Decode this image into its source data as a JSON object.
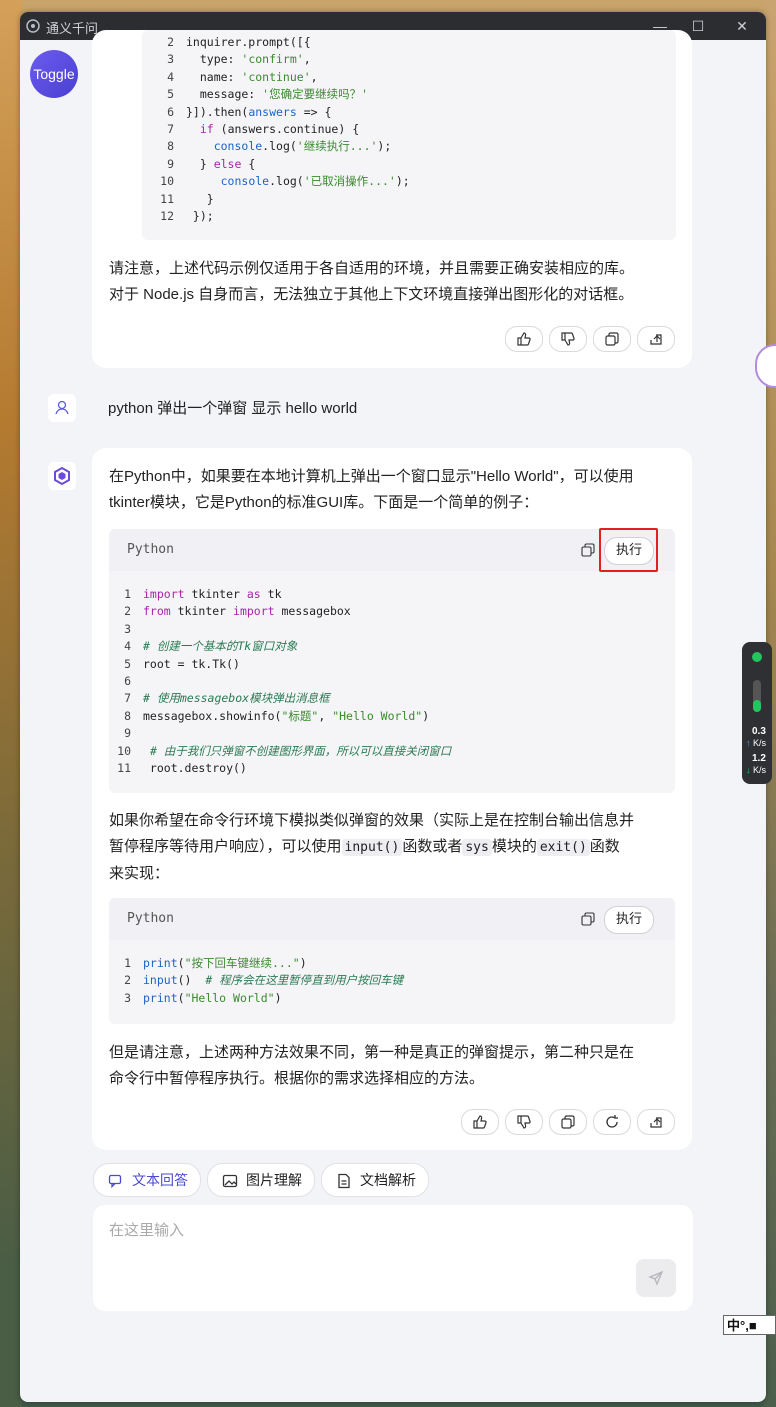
{
  "window": {
    "title": "通义千问"
  },
  "toggle_label": "Toggle",
  "prev_code": {
    "lines": [
      {
        "n": "2",
        "html": "inquirer.prompt([{"
      },
      {
        "n": "3",
        "html": "  type: <span class='str'>'confirm'</span>,"
      },
      {
        "n": "4",
        "html": "  name: <span class='str'>'continue'</span>,"
      },
      {
        "n": "5",
        "html": "  message: <span class='str'>'您确定要继续吗？'</span>"
      },
      {
        "n": "6",
        "html": "}]).then(<span class='var'>answers</span> => {"
      },
      {
        "n": "7",
        "html": "  <span class='kw'>if</span> (answers.continue) {"
      },
      {
        "n": "8",
        "html": "    <span class='fn'>console</span>.log(<span class='str'>'继续执行...'</span>);"
      },
      {
        "n": "9",
        "html": "  } <span class='kw'>else</span> {"
      },
      {
        "n": "10",
        "html": "     <span class='fn'>console</span>.log(<span class='str'>'已取消操作...'</span>);"
      },
      {
        "n": "11",
        "html": "   }"
      },
      {
        "n": "12",
        "html": " });"
      }
    ]
  },
  "prev_answer_text": [
    "请注意，上述代码示例仅适用于各自适用的环境，并且需要正确安装相应的库。",
    "对于 Node.js 自身而言，无法独立于其他上下文环境直接弹出图形化的对话框。"
  ],
  "user_message": "python 弹出一个弹窗 显示 hello world",
  "answer": {
    "intro": [
      "在Python中，如果要在本地计算机上弹出一个窗口显示\"Hello World\"，可以使用",
      "tkinter模块，它是Python的标准GUI库。下面是一个简单的例子："
    ],
    "code1": {
      "lang": "Python",
      "run_label": "执行",
      "lines": [
        {
          "n": "1",
          "html": "<span class='kw'>import</span> tkinter <span class='kw'>as</span> tk"
        },
        {
          "n": "2",
          "html": "<span class='kw'>from</span> tkinter <span class='kw'>import</span> messagebox"
        },
        {
          "n": "3",
          "html": ""
        },
        {
          "n": "4",
          "html": "<span class='cm'># 创建一个基本的Tk窗口对象</span>"
        },
        {
          "n": "5",
          "html": "root = tk.Tk()"
        },
        {
          "n": "6",
          "html": ""
        },
        {
          "n": "7",
          "html": "<span class='cm'># 使用messagebox模块弹出消息框</span>"
        },
        {
          "n": "8",
          "html": "messagebox.showinfo(<span class='str'>\"标题\"</span>, <span class='str'>\"Hello World\"</span>)"
        },
        {
          "n": "9",
          "html": ""
        },
        {
          "n": "10",
          "html": " <span class='cm'># 由于我们只弹窗不创建图形界面，所以可以直接关闭窗口</span>"
        },
        {
          "n": "11",
          "html": " root.destroy()"
        }
      ]
    },
    "middle": {
      "l1": "如果你希望在命令行环境下模拟类似弹窗的效果（实际上是在控制台输出信息并",
      "l2a": "暂停程序等待用户响应），可以使用",
      "c1": "input()",
      "l2b": "函数或者",
      "c2": "sys",
      "l2c": "模块的",
      "c3": "exit()",
      "l2d": "函数",
      "l3": "来实现："
    },
    "code2": {
      "lang": "Python",
      "run_label": "执行",
      "lines": [
        {
          "n": "1",
          "html": "<span class='fn'>print</span>(<span class='str'>\"按下回车键继续...\"</span>)"
        },
        {
          "n": "2",
          "html": "<span class='fn'>input</span>()  <span class='cm'># 程序会在这里暂停直到用户按回车键</span>"
        },
        {
          "n": "3",
          "html": "<span class='fn'>print</span>(<span class='str'>\"Hello World\"</span>)"
        }
      ]
    },
    "outro": [
      "但是请注意，上述两种方法效果不同，第一种是真正的弹窗提示，第二种只是在",
      "命令行中暂停程序执行。根据你的需求选择相应的方法。"
    ]
  },
  "chips": {
    "text": "文本回答",
    "image": "图片理解",
    "doc": "文档解析"
  },
  "input": {
    "placeholder": "在这里输入"
  },
  "net_widget": {
    "up": "0.3",
    "up_unit": "K/s",
    "down": "1.2",
    "down_unit": "K/s"
  },
  "ime": "中°,"
}
